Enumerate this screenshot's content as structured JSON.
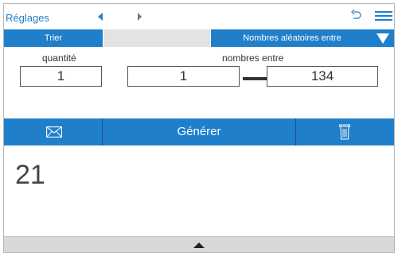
{
  "header": {
    "back_label": "Réglages",
    "prev_icon": "triangle-left-icon",
    "next_icon": "triangle-right-icon",
    "undo_icon": "undo-icon",
    "menu_icon": "hamburger-menu-icon"
  },
  "tabs": {
    "sort_label": "Trier",
    "random_label": "Nombres aléatoires entre",
    "random_dropdown_icon": "caret-down-icon"
  },
  "form": {
    "quantity_label": "quantité",
    "quantity_value": "1",
    "range_label": "nombres entre",
    "range_min": "1",
    "range_max": "134"
  },
  "actions": {
    "mail_icon": "envelope-icon",
    "generate_label": "Générer",
    "trash_icon": "trash-icon"
  },
  "result": {
    "value": "21"
  },
  "footer": {
    "expand_icon": "caret-up-icon"
  },
  "colors": {
    "accent": "#1f7fcb",
    "bottom_bar": "#d8d8d8",
    "tab_gap": "#e3e3e3"
  }
}
